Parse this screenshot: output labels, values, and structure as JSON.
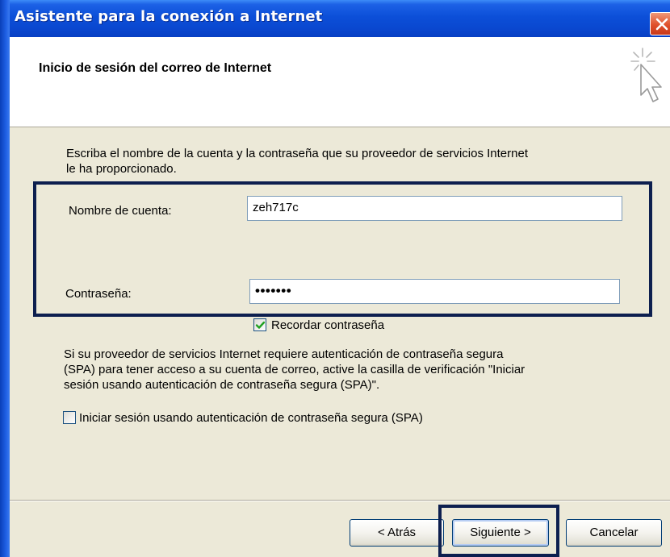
{
  "window": {
    "title": "Asistente para la conexión a Internet",
    "close_icon": "close-icon"
  },
  "header": {
    "title": "Inicio de sesión del correo de Internet",
    "icon": "wizard-cursor-icon"
  },
  "content": {
    "intro_line1": "Escriba el nombre de la cuenta y la contraseña que su proveedor de servicios Internet",
    "intro_line2": "le ha proporcionado.",
    "account_label": "Nombre de cuenta:",
    "account_value": "zeh717c",
    "password_label": "Contraseña:",
    "password_masked": "•••••••",
    "remember_password": {
      "label": "Recordar contraseña",
      "checked": true
    },
    "spa_line1": "Si su proveedor de servicios Internet requiere autenticación de contraseña segura",
    "spa_line2": "(SPA) para tener acceso a su cuenta de correo, active la casilla de verificación \"Iniciar",
    "spa_line3": "sesión usando autenticación de contraseña segura (SPA)\".",
    "spa_checkbox": {
      "label": "Iniciar sesión usando autenticación de contraseña segura (SPA)",
      "checked": false
    }
  },
  "buttons": {
    "back": "< Atrás",
    "next": "Siguiente >",
    "cancel": "Cancelar"
  },
  "colors": {
    "highlight_border": "#0d1f4f",
    "title_bar": "#0a48d0",
    "dialog_bg": "#ece9d8"
  }
}
